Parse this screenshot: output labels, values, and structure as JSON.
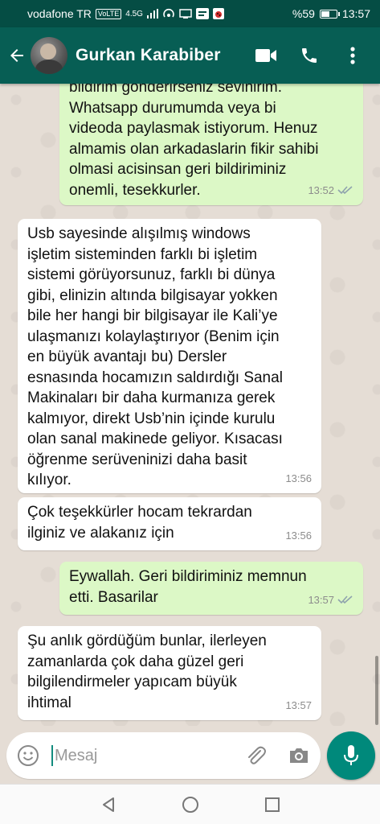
{
  "status_bar": {
    "carrier": "vodafone TR",
    "volte": "VoLTE",
    "network": "4.5G",
    "battery_percent": "%59",
    "battery_level": 0.59,
    "time": "13:57"
  },
  "header": {
    "contact_name": "Gurkan Karabiber",
    "icons": [
      "back-arrow-icon",
      "video-call-icon",
      "phone-call-icon",
      "more-vert-icon"
    ]
  },
  "messages": [
    {
      "direction": "out",
      "text": "bildirim  gonderirseniz sevinirim.\nWhatsapp durumumda  veya bi\nvideoda paylasmak istiyorum. Henuz\nalmamis olan arkadaslarin fikir sahibi\nolmasi acisinsan geri bildiriminiz\nonemli,   tesekkurler.",
      "time": "13:52",
      "read": true
    },
    {
      "direction": "in",
      "text": "Usb sayesinde alışılmış windows\nişletim sisteminden farklı bi işletim\nsistemi görüyorsunuz, farklı bi dünya\ngibi, elinizin altında bilgisayar yokken\nbile her hangi bir bilgisayar ile Kali’ye\nulaşmanızı kolaylaştırıyor (Benim için\nen büyük avantajı bu) Dersler\nesnasında hocamızın saldırdığı Sanal\nMakinaları bir daha kurmanıza gerek\nkalmıyor, direkt Usb’nin içinde kurulu\nolan sanal makinede geliyor. Kısacası\nöğrenme serüveninizi daha basit\nkılıyor.",
      "time": "13:56"
    },
    {
      "direction": "in",
      "text": "Çok teşekkürler hocam tekrardan\nilginiz ve alakanız için",
      "time": "13:56"
    },
    {
      "direction": "out",
      "text": "Eywallah.  Geri bildiriminiz memnun\netti. Basarilar",
      "time": "13:57",
      "read": true
    },
    {
      "direction": "in",
      "text": "Şu anlık gördüğüm bunlar, ilerleyen\nzamanlarda çok daha güzel geri\nbilgilendirmeler yapıcam büyük\nihtimal",
      "time": "13:57"
    }
  ],
  "composer": {
    "placeholder": "Mesaj",
    "icons": [
      "emoji-icon",
      "attach-icon",
      "camera-icon",
      "mic-icon"
    ]
  },
  "colors": {
    "header": "#075e54",
    "status_bar": "#054d44",
    "outgoing_bubble": "#dcf8c6",
    "incoming_bubble": "#ffffff",
    "read_ticks": "#8fa3ad",
    "mic_button": "#00897b"
  }
}
